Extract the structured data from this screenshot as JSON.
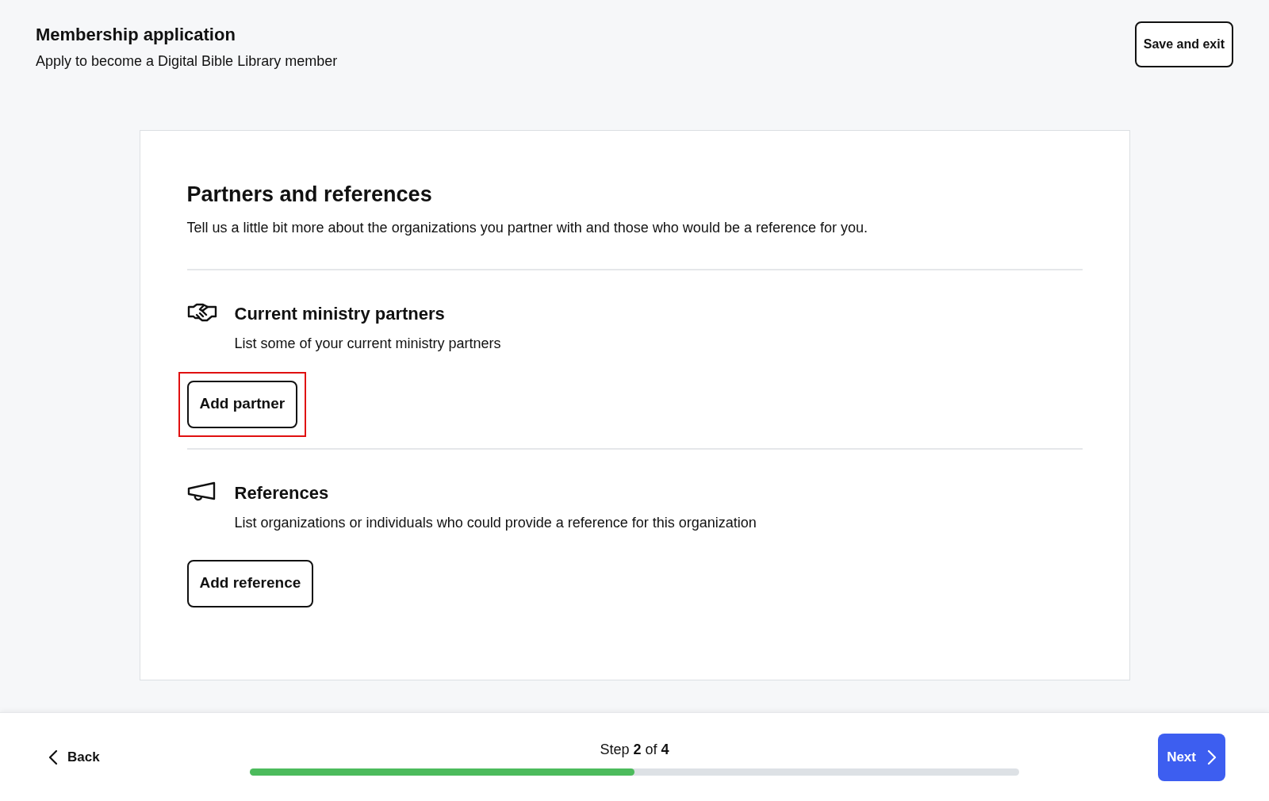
{
  "header": {
    "title": "Membership application",
    "subtitle": "Apply to become a Digital Bible Library member",
    "save_button": "Save and exit"
  },
  "card": {
    "title": "Partners and references",
    "description": "Tell us a little bit more about the organizations you partner with and those who would be a reference for you.",
    "sections": [
      {
        "kind": "partners",
        "title": "Current ministry partners",
        "description": "List some of your current ministry partners",
        "button": "Add partner",
        "highlighted": true
      },
      {
        "kind": "references",
        "title": "References",
        "description": "List organizations or individuals who could provide a reference for this organization",
        "button": "Add reference",
        "highlighted": false
      }
    ]
  },
  "footer": {
    "back": "Back",
    "step": "Step **2** of **4**",
    "progress": {
      "level": 0.5
    },
    "next": "Next"
  }
}
